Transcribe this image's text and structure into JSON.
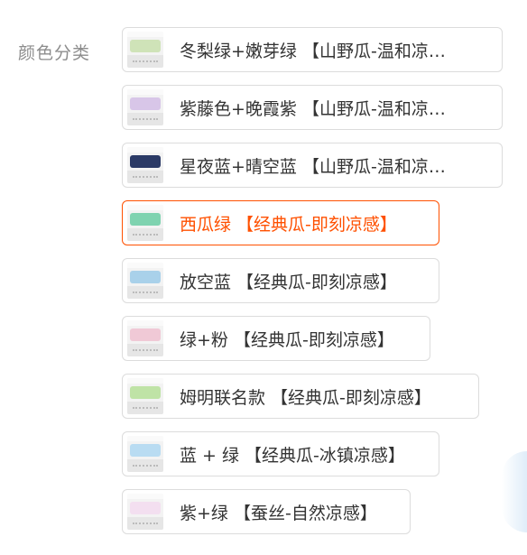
{
  "section_label": "颜色分类",
  "options": [
    {
      "label": "冬梨绿+嫩芽绿 【山野瓜-温和凉…",
      "selected": false,
      "swatch": "#cfe3b8",
      "width": 422
    },
    {
      "label": "紫藤色+晚霞紫 【山野瓜-温和凉…",
      "selected": false,
      "swatch": "#d8c6e8",
      "width": 422
    },
    {
      "label": "星夜蓝+晴空蓝 【山野瓜-温和凉…",
      "selected": false,
      "swatch": "#2b3a66",
      "width": 422
    },
    {
      "label": "西瓜绿 【经典瓜-即刻凉感】",
      "selected": true,
      "swatch": "#7fd3b0",
      "width": 352
    },
    {
      "label": "放空蓝 【经典瓜-即刻凉感】",
      "selected": false,
      "swatch": "#a9d1ea",
      "width": 352
    },
    {
      "label": "绿+粉 【经典瓜-即刻凉感】",
      "selected": false,
      "swatch": "#f0c9d6",
      "width": 342
    },
    {
      "label": "姆明联名款 【经典瓜-即刻凉感】",
      "selected": false,
      "swatch": "#bfe3a6",
      "width": 396
    },
    {
      "label": "蓝 + 绿 【经典瓜-冰镇凉感】",
      "selected": false,
      "swatch": "#b9dcf2",
      "width": 352
    },
    {
      "label": "紫+绿 【蚕丝-自然凉感】",
      "selected": false,
      "swatch": "#f3dff0",
      "width": 320
    }
  ]
}
